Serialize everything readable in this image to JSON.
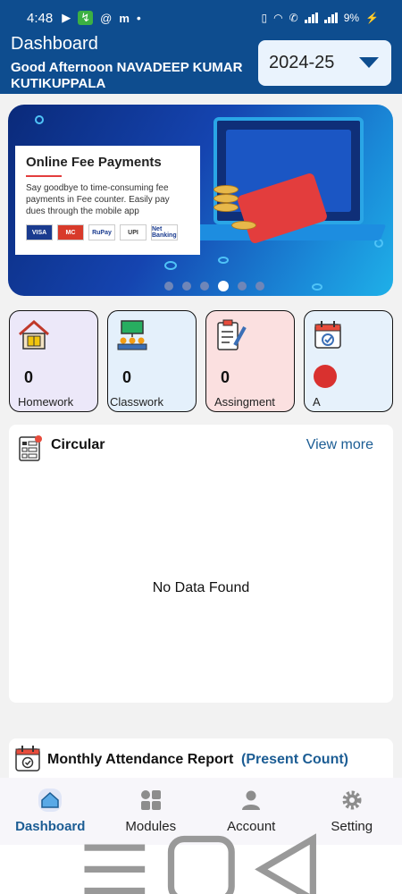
{
  "status_bar": {
    "time": "4:48",
    "battery": "9%"
  },
  "header": {
    "title": "Dashboard",
    "greeting": "Good Afternoon NAVADEEP KUMAR KUTIKUPPALA",
    "year_select": {
      "selected": "2024-25"
    }
  },
  "banner": {
    "heading": "Online Fee Payments",
    "text": "Say goodbye to time-consuming fee payments in Fee counter. Easily pay dues through the mobile app",
    "payment_logos": [
      "VISA",
      "MC",
      "RuPay",
      "UPI",
      "Net Banking"
    ],
    "slide_count": 6,
    "active_slide": 3
  },
  "tiles": [
    {
      "label": "Homework",
      "count": "0",
      "color": "#ece8f9"
    },
    {
      "label": "Classwork",
      "count": "0",
      "color": "#e4f0fb"
    },
    {
      "label": "Assingment",
      "count": "0",
      "color": "#fbe0e0"
    },
    {
      "label": "A",
      "count": "",
      "color": "#e6f1fb"
    }
  ],
  "circular": {
    "title": "Circular",
    "view_more": "View more",
    "empty_text": "No Data Found"
  },
  "attendance": {
    "title": "Monthly Attendance Report",
    "subtitle": "(Present Count)"
  },
  "bottom_nav": [
    {
      "label": "Dashboard",
      "icon": "home-icon",
      "active": true
    },
    {
      "label": "Modules",
      "icon": "grid-icon",
      "active": false
    },
    {
      "label": "Account",
      "icon": "person-icon",
      "active": false
    },
    {
      "label": "Setting",
      "icon": "gear-icon",
      "active": false
    }
  ],
  "colors": {
    "header": "#0e4d8f",
    "accent": "#1c5d94"
  }
}
